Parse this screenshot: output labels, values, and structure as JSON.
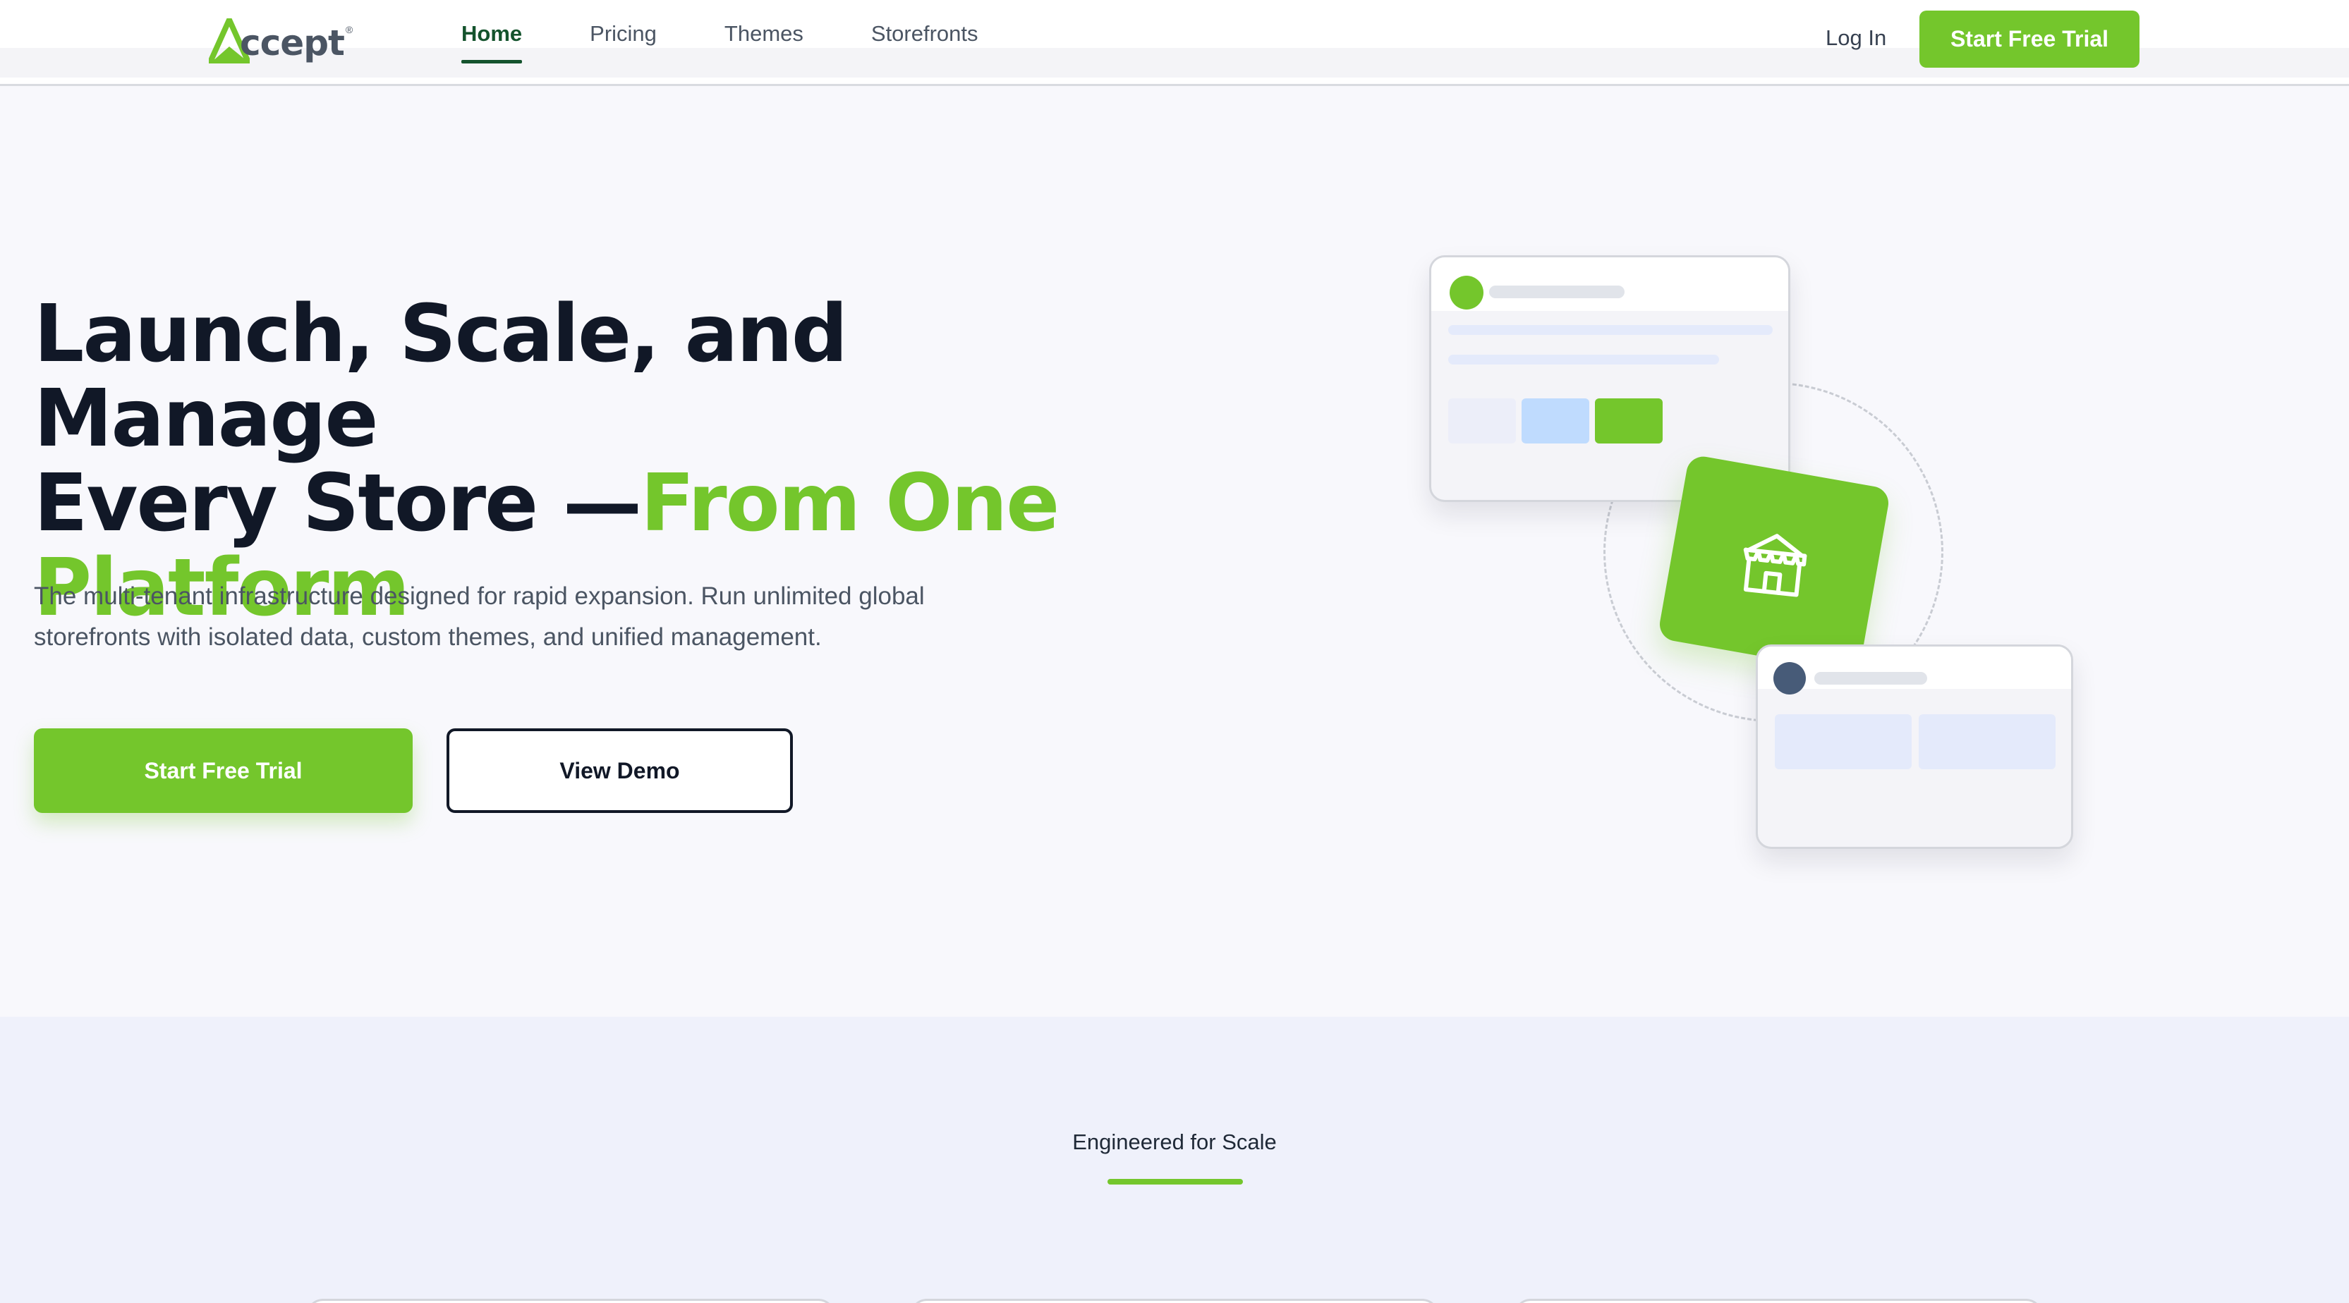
{
  "brand": {
    "name": "ccept",
    "registered": "®",
    "accent_color": "#74c62c",
    "text_color": "#111827"
  },
  "nav": {
    "links": [
      {
        "label": "Home",
        "active": true
      },
      {
        "label": "Pricing",
        "active": false
      },
      {
        "label": "Themes",
        "active": false
      },
      {
        "label": "Storefronts",
        "active": false
      }
    ],
    "login_label": "Log In",
    "cta_label": "Start Free Trial"
  },
  "hero": {
    "title_part1": "Launch, Scale, and Manage",
    "title_part2": "Every Store —",
    "title_accent": "From One Platform",
    "subtitle_line1": "The multi-tenant infrastructure designed for rapid expansion. Run unlimited global",
    "subtitle_line2": "storefronts with isolated data, custom themes, and unified management.",
    "primary_cta": "Start Free Trial",
    "secondary_cta": "View Demo",
    "illustration_icon": "storefront-icon"
  },
  "features": {
    "section_label": "Engineered for Scale"
  }
}
